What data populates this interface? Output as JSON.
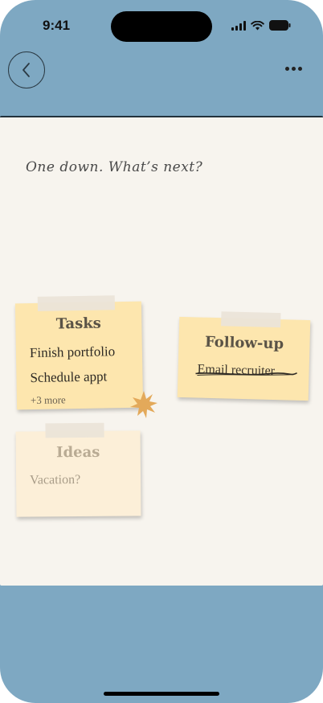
{
  "status_bar": {
    "time": "9:41"
  },
  "board": {
    "headline": "One down. What’s next?"
  },
  "notes": {
    "tasks": {
      "title": "Tasks",
      "items": [
        "Finish portfolio",
        "Schedule appt"
      ],
      "more": "+3 more"
    },
    "followup": {
      "title": "Follow-up",
      "items": [
        "Email recruiter"
      ]
    },
    "ideas": {
      "title": "Ideas",
      "items": [
        "Vacation?"
      ]
    }
  },
  "colors": {
    "background": "#7ea8c2",
    "board": "#f7f4ee",
    "note": "#fde6ae",
    "note_faded": "#fcefd8",
    "burst": "#e3a95a"
  },
  "icons": {
    "back": "chevron-left-icon",
    "more": "more-horizontal-icon",
    "burst": "star-burst-icon"
  }
}
